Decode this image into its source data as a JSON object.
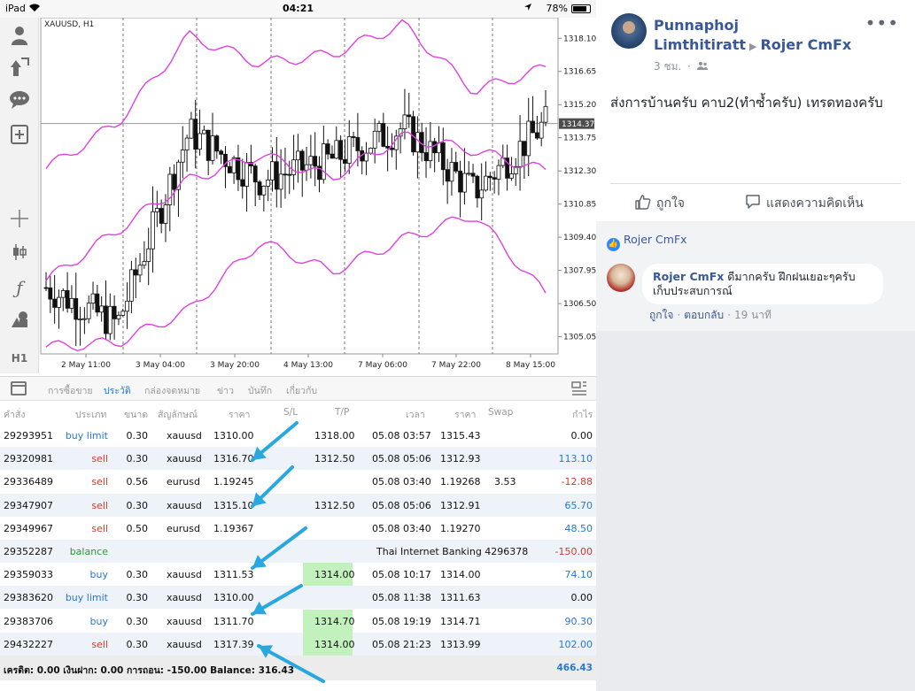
{
  "status_bar": {
    "device": "iPad",
    "clock": "04:21",
    "battery": "78%"
  },
  "chart": {
    "symbol_label": "XAUUSD, H1",
    "current_price": "1314.37",
    "y_ticks": [
      "1318.10",
      "1316.65",
      "1315.20",
      "1313.75",
      "1312.30",
      "1310.85",
      "1309.40",
      "1307.95",
      "1306.50",
      "1305.05"
    ],
    "x_ticks": [
      "2 May 11:00",
      "3 May 04:00",
      "3 May 20:00",
      "4 May 13:00",
      "7 May 06:00",
      "7 May 22:00",
      "8 May 15:00"
    ]
  },
  "chart_data": {
    "type": "line",
    "title": "XAUUSD, H1",
    "xlabel": "",
    "ylabel": "",
    "ylim": [
      1304.3,
      1319.0
    ],
    "x": [
      "2 May 11:00",
      "3 May 04:00",
      "3 May 20:00",
      "4 May 13:00",
      "7 May 06:00",
      "7 May 22:00",
      "8 May 15:00"
    ],
    "series": [
      {
        "name": "",
        "values": [
          1307.2,
          1305.6,
          1314.0,
          1311.9,
          1312.8,
          1314.2,
          1311.4,
          1314.4
        ]
      }
    ],
    "bollinger_upper_approx": [
      1312.4,
      1314.4,
      1318.2,
      1317.0,
      1317.4,
      1318.7,
      1315.8,
      1316.8
    ],
    "bollinger_mid_approx": [
      1307.5,
      1309.7,
      1311.9,
      1313.0,
      1312.0,
      1313.8,
      1313.2,
      1312.3
    ],
    "bollinger_lower_approx": [
      1304.6,
      1304.8,
      1306.2,
      1309.2,
      1307.9,
      1309.3,
      1310.4,
      1306.9
    ],
    "current_price": 1314.37,
    "grid": true
  },
  "toolbar_icons": [
    "account-icon",
    "arrow-icon",
    "chat-icon",
    "add-window-icon",
    "crosshair-icon",
    "indicators-icon",
    "function-icon",
    "objects-icon",
    "timeframe-label"
  ],
  "timeframe": "H1",
  "tabs": [
    "การซื้อขาย",
    "ประวัติ",
    "กล่องจดหมาย",
    "ข่าว",
    "บันทึก",
    "เกี่ยวกับ"
  ],
  "active_tab": "ประวัติ",
  "table_headers": [
    "คำสั่ง",
    "ประเภท",
    "ขนาด",
    "สัญลักษณ์",
    "ราคา",
    "S/L",
    "T/P",
    "เวลา",
    "ราคา",
    "Swap",
    "กำไร"
  ],
  "rows": [
    {
      "order": "29293951",
      "type": "buy limit",
      "size": "0.30",
      "symbol": "xauusd",
      "price": "1310.00",
      "tp": "1318.00",
      "tp_hi": false,
      "time": "05.08 03:57",
      "close": "1315.43",
      "swap": "",
      "profit": "0.00",
      "type_class": "blue",
      "profit_class": ""
    },
    {
      "order": "29320981",
      "type": "sell",
      "size": "0.30",
      "symbol": "xauusd",
      "price": "1316.70",
      "tp": "1312.50",
      "tp_hi": false,
      "time": "05.08 05:06",
      "close": "1312.93",
      "swap": "",
      "profit": "113.10",
      "type_class": "red",
      "profit_class": "blue"
    },
    {
      "order": "29336489",
      "type": "sell",
      "size": "0.56",
      "symbol": "eurusd",
      "price": "1.19245",
      "tp": "",
      "tp_hi": false,
      "time": "05.08 03:40",
      "close": "1.19268",
      "swap": "3.53",
      "profit": "-12.88",
      "type_class": "red",
      "profit_class": "red"
    },
    {
      "order": "29347907",
      "type": "sell",
      "size": "0.30",
      "symbol": "xauusd",
      "price": "1315.10",
      "tp": "1312.50",
      "tp_hi": false,
      "time": "05.08 05:06",
      "close": "1312.91",
      "swap": "",
      "profit": "65.70",
      "type_class": "red",
      "profit_class": "blue"
    },
    {
      "order": "29349967",
      "type": "sell",
      "size": "0.50",
      "symbol": "eurusd",
      "price": "1.19367",
      "tp": "",
      "tp_hi": false,
      "time": "05.08 03:40",
      "close": "1.19270",
      "swap": "",
      "profit": "48.50",
      "type_class": "red",
      "profit_class": "blue"
    },
    {
      "order": "29352287",
      "type": "balance",
      "size": "",
      "symbol": "",
      "price": "",
      "tp": "",
      "tp_hi": false,
      "time": "",
      "close": "",
      "swap": "",
      "comment": "Thai Internet Banking 4296378",
      "profit": "-150.00",
      "type_class": "green",
      "profit_class": "red"
    },
    {
      "order": "29359033",
      "type": "buy",
      "size": "0.30",
      "symbol": "xauusd",
      "price": "1311.53",
      "tp": "1314.00",
      "tp_hi": true,
      "time": "05.08 10:17",
      "close": "1314.00",
      "swap": "",
      "profit": "74.10",
      "type_class": "blue",
      "profit_class": "blue"
    },
    {
      "order": "29383620",
      "type": "buy limit",
      "size": "0.30",
      "symbol": "xauusd",
      "price": "1310.00",
      "tp": "",
      "tp_hi": false,
      "time": "05.08 11:38",
      "close": "1311.63",
      "swap": "",
      "profit": "0.00",
      "type_class": "blue",
      "profit_class": ""
    },
    {
      "order": "29383706",
      "type": "buy",
      "size": "0.30",
      "symbol": "xauusd",
      "price": "1311.70",
      "tp": "1314.70",
      "tp_hi": true,
      "time": "05.08 19:19",
      "close": "1314.71",
      "swap": "",
      "profit": "90.30",
      "type_class": "blue",
      "profit_class": "blue"
    },
    {
      "order": "29432227",
      "type": "sell",
      "size": "0.30",
      "symbol": "xauusd",
      "price": "1317.39",
      "tp": "1314.00",
      "tp_hi": true,
      "time": "05.08 21:23",
      "close": "1313.99",
      "swap": "",
      "profit": "102.00",
      "type_class": "red",
      "profit_class": "blue"
    }
  ],
  "footer": {
    "summary": "เครดิต: 0.00 เงินฝาก: 0.00 การถอน: -150.00 Balance: 316.43",
    "total": "466.43"
  },
  "post": {
    "author": "Punnaphoj Limthitiratt",
    "target": "Rojer CmFx",
    "time": "3 ชม.",
    "audience_icon": "friends-icon",
    "text": "ส่งการบ้านครับ คาบ2(ทำซ้ำครับ) เทรดทองครับ",
    "like_label": "ถูกใจ",
    "comment_label": "แสดงความคิดเห็น"
  },
  "comments": {
    "reactor": "Rojer CmFx",
    "items": [
      {
        "name": "Rojer CmFx",
        "text": "ดีมากครับ ฝึกฝนเยอะๆครับ เก็บประสบการณ์",
        "like": "ถูกใจ",
        "reply": "ตอบกลับ",
        "ago": "19 นาที"
      }
    ]
  },
  "colors": {
    "fb_blue": "#385898",
    "bollinger": "#e040e0",
    "blue_text": "#2678d4",
    "red_text": "#d23a2a",
    "tp_highlight": "#c3f1be",
    "arrow": "#29a8e0"
  }
}
